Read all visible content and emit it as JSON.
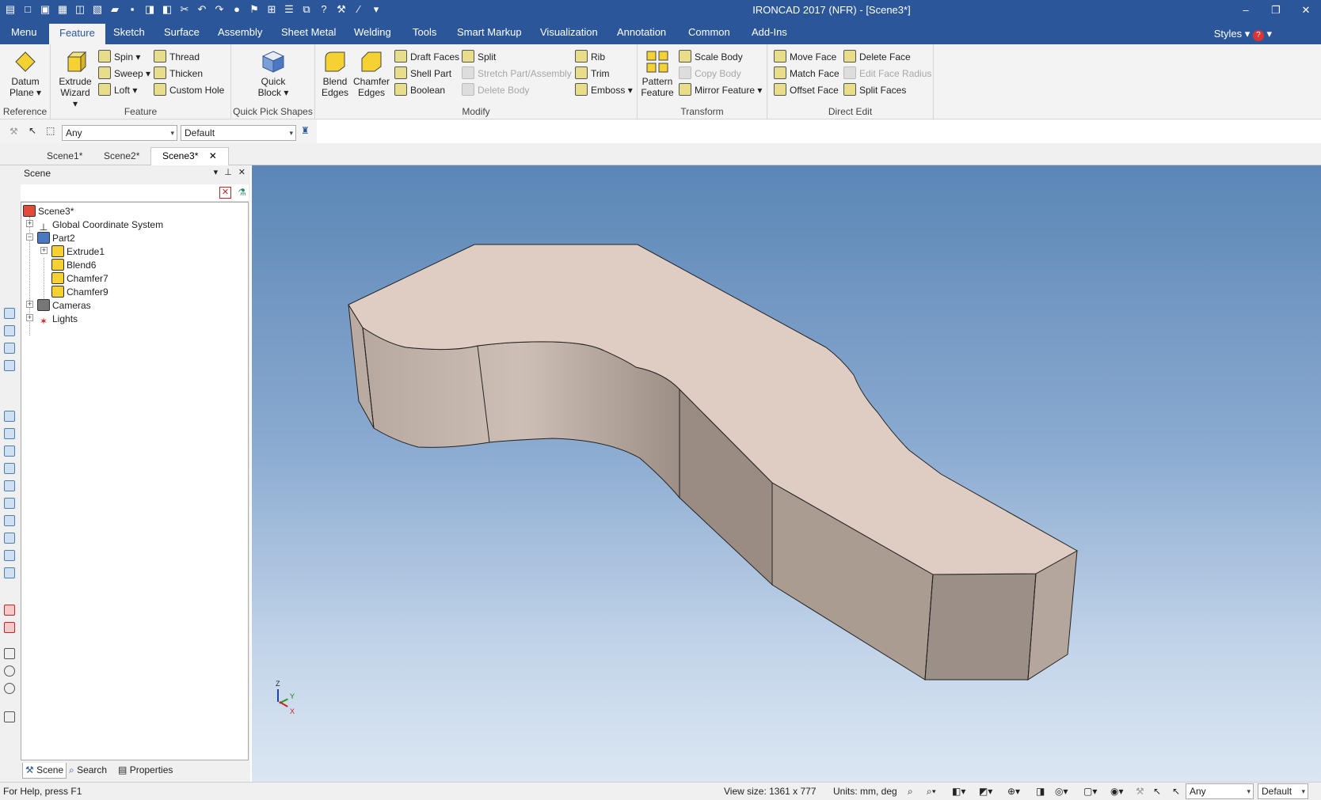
{
  "app": {
    "window_title": "IRONCAD 2017 (NFR) - [Scene3*]",
    "window_controls": [
      "minimize-icon",
      "restore-icon",
      "close-icon"
    ]
  },
  "ribbon_tabs": [
    "Menu",
    "Feature",
    "Sketch",
    "Surface",
    "Assembly",
    "Sheet Metal",
    "Welding",
    "Tools",
    "Smart Markup",
    "Visualization",
    "Annotation",
    "Common",
    "Add-Ins"
  ],
  "active_ribbon_tab": "Feature",
  "styles_label": "Styles",
  "ribbon": {
    "reference": {
      "label": "Reference",
      "datum_plane": "Datum\nPlane"
    },
    "feature": {
      "label": "Feature",
      "extrude_wizard": "Extrude\nWizard",
      "spin": "Spin",
      "sweep": "Sweep",
      "loft": "Loft",
      "thread": "Thread",
      "thicken": "Thicken",
      "custom_hole": "Custom Hole"
    },
    "quick_pick": {
      "label": "Quick Pick Shapes",
      "quick_block": "Quick\nBlock"
    },
    "modify": {
      "label": "Modify",
      "blend_edges": "Blend\nEdges",
      "chamfer_edges": "Chamfer\nEdges",
      "draft_faces": "Draft Faces",
      "shell_part": "Shell Part",
      "boolean": "Boolean",
      "split": "Split",
      "stretch": "Stretch Part/Assembly",
      "delete_body": "Delete Body",
      "rib": "Rib",
      "trim": "Trim",
      "emboss": "Emboss"
    },
    "transform": {
      "label": "Transform",
      "pattern_feature": "Pattern\nFeature",
      "scale_body": "Scale Body",
      "copy_body": "Copy Body",
      "mirror_feature": "Mirror Feature"
    },
    "direct_edit": {
      "label": "Direct Edit",
      "move_face": "Move Face",
      "match_face": "Match Face",
      "offset_face": "Offset Face",
      "delete_face": "Delete Face",
      "edit_face_radius": "Edit Face Radius",
      "split_faces": "Split Faces"
    }
  },
  "selection_toolbar": {
    "filter_value": "Any",
    "style_value": "Default"
  },
  "doc_tabs": [
    "Scene1*",
    "Scene2*",
    "Scene3*"
  ],
  "active_doc_tab": "Scene3*",
  "scene_panel": {
    "title": "Scene",
    "tree": [
      {
        "label": "Scene3*",
        "level": 0,
        "expander": "",
        "icon": "scene-icon"
      },
      {
        "label": "Global Coordinate System",
        "level": 1,
        "expander": "+",
        "icon": "coordinate-system-icon"
      },
      {
        "label": "Part2",
        "level": 1,
        "expander": "-",
        "icon": "part-icon"
      },
      {
        "label": "Extrude1",
        "level": 2,
        "expander": "+",
        "icon": "extrude-icon"
      },
      {
        "label": "Blend6",
        "level": 2,
        "expander": "",
        "icon": "blend-icon"
      },
      {
        "label": "Chamfer7",
        "level": 2,
        "expander": "",
        "icon": "chamfer-icon"
      },
      {
        "label": "Chamfer9",
        "level": 2,
        "expander": "",
        "icon": "chamfer-icon"
      },
      {
        "label": "Cameras",
        "level": 1,
        "expander": "+",
        "icon": "camera-icon"
      },
      {
        "label": "Lights",
        "level": 1,
        "expander": "+",
        "icon": "light-icon"
      }
    ],
    "bottom_tabs": [
      "Scene",
      "Search",
      "Properties"
    ]
  },
  "triad": {
    "z": "Z",
    "y": "Y",
    "x": "X"
  },
  "status": {
    "help": "For Help, press F1",
    "view_size": "View size: 1361 x  777",
    "units": "Units: mm, deg",
    "filter_value": "Any",
    "style_value": "Default"
  },
  "colors": {
    "titlebar": "#2b579a",
    "ribbon_bg": "#f3f3f3",
    "part_top": "#dfcdc3",
    "part_side": "#a89a90"
  }
}
